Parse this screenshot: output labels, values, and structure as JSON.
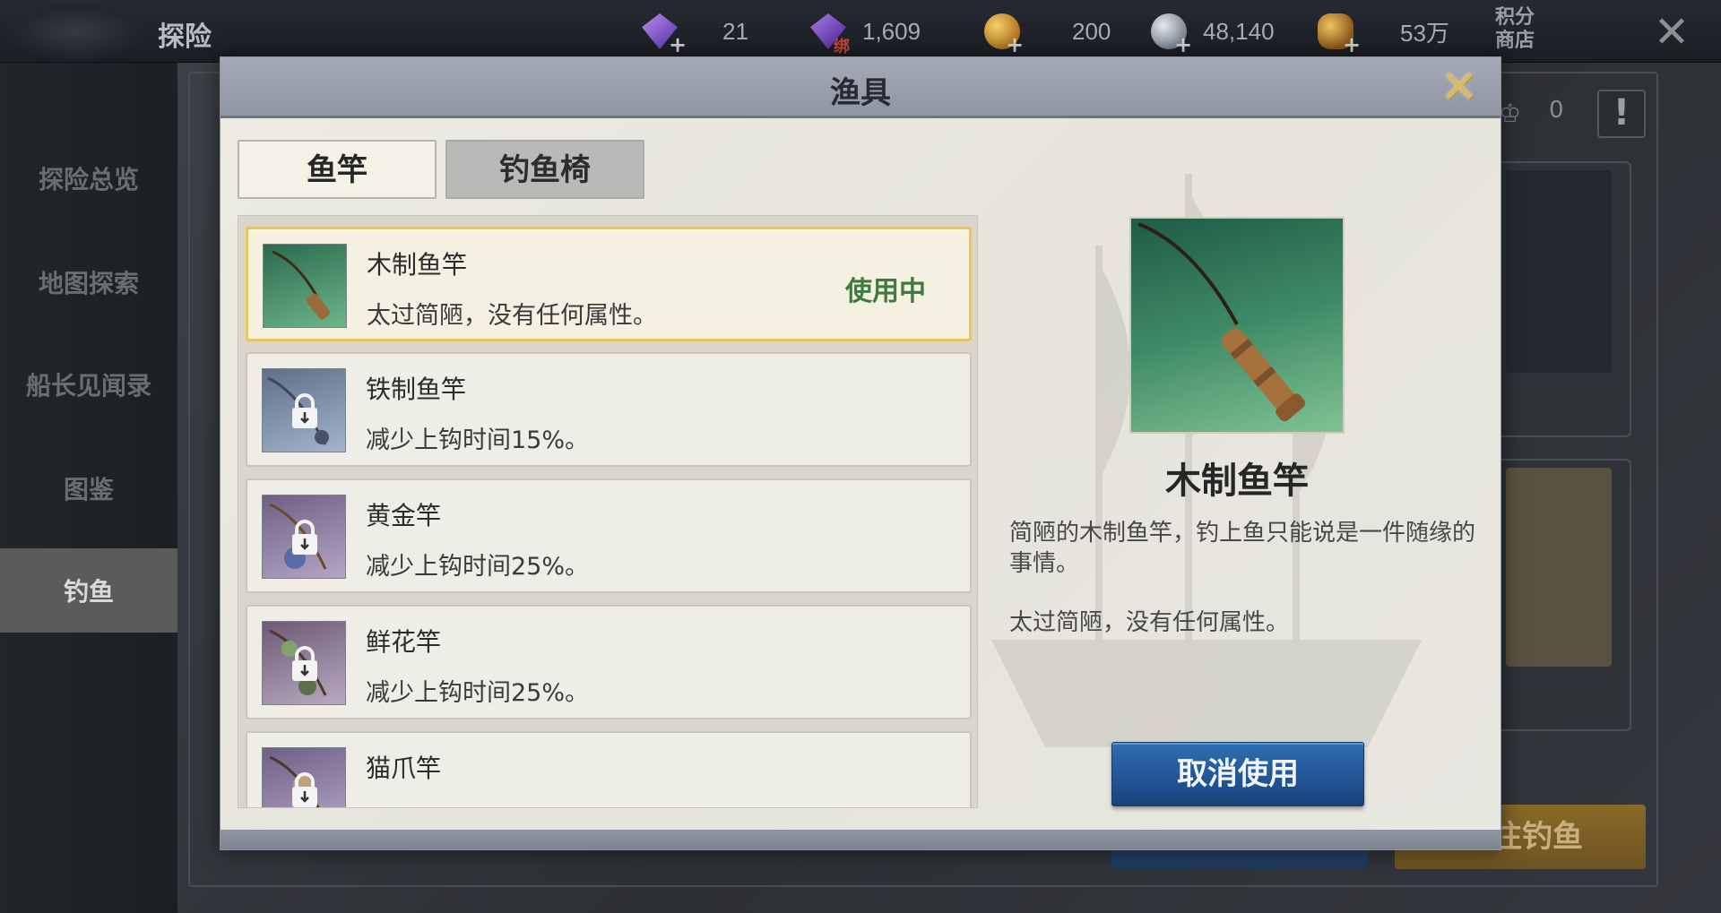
{
  "topbar": {
    "title": "探险",
    "currencies": [
      {
        "icon": "purple-gem-icon",
        "value": "21"
      },
      {
        "icon": "bound-purple-gem-icon",
        "value": "1,609",
        "badge": "绑"
      },
      {
        "icon": "gold-coin-icon",
        "value": "200"
      },
      {
        "icon": "silver-coin-icon",
        "value": "48,140"
      },
      {
        "icon": "coin-stack-icon",
        "value": "53万"
      }
    ],
    "points_shop": "积分商店"
  },
  "sidebar": {
    "items": [
      {
        "label": "探险总览",
        "active": false
      },
      {
        "label": "地图探索",
        "active": false
      },
      {
        "label": "船长见闻录",
        "active": false
      },
      {
        "label": "图鉴",
        "active": false
      },
      {
        "label": "钓鱼",
        "active": true
      }
    ]
  },
  "background": {
    "crown_count": "0",
    "go_fishing_partial": "往钓鱼"
  },
  "dialog": {
    "title": "渔具",
    "tabs": [
      {
        "label": "鱼竿",
        "active": true
      },
      {
        "label": "钓鱼椅",
        "active": false
      }
    ],
    "rods": [
      {
        "name": "木制鱼竿",
        "desc": "太过简陋，没有任何属性。",
        "status": "使用中",
        "locked": false,
        "theme": "green"
      },
      {
        "name": "铁制鱼竿",
        "desc": "减少上钩时间15%。",
        "status": "",
        "locked": true,
        "theme": "blue"
      },
      {
        "name": "黄金竿",
        "desc": "减少上钩时间25%。",
        "status": "",
        "locked": true,
        "theme": "purple"
      },
      {
        "name": "鲜花竿",
        "desc": "减少上钩时间25%。",
        "status": "",
        "locked": true,
        "theme": "pink"
      },
      {
        "name": "猫爪竿",
        "desc": "",
        "status": "",
        "locked": true,
        "theme": "purple"
      }
    ],
    "detail": {
      "name": "木制鱼竿",
      "description": "简陋的木制鱼竿，钓上鱼只能说是一件随缘的事情。",
      "attribute": "太过简陋，没有任何属性。",
      "action_label": "取消使用"
    }
  },
  "colors": {
    "selected_border": "#e7c36a",
    "in_use_text": "#3f7a3e",
    "action_button": "#1f4f8d"
  }
}
